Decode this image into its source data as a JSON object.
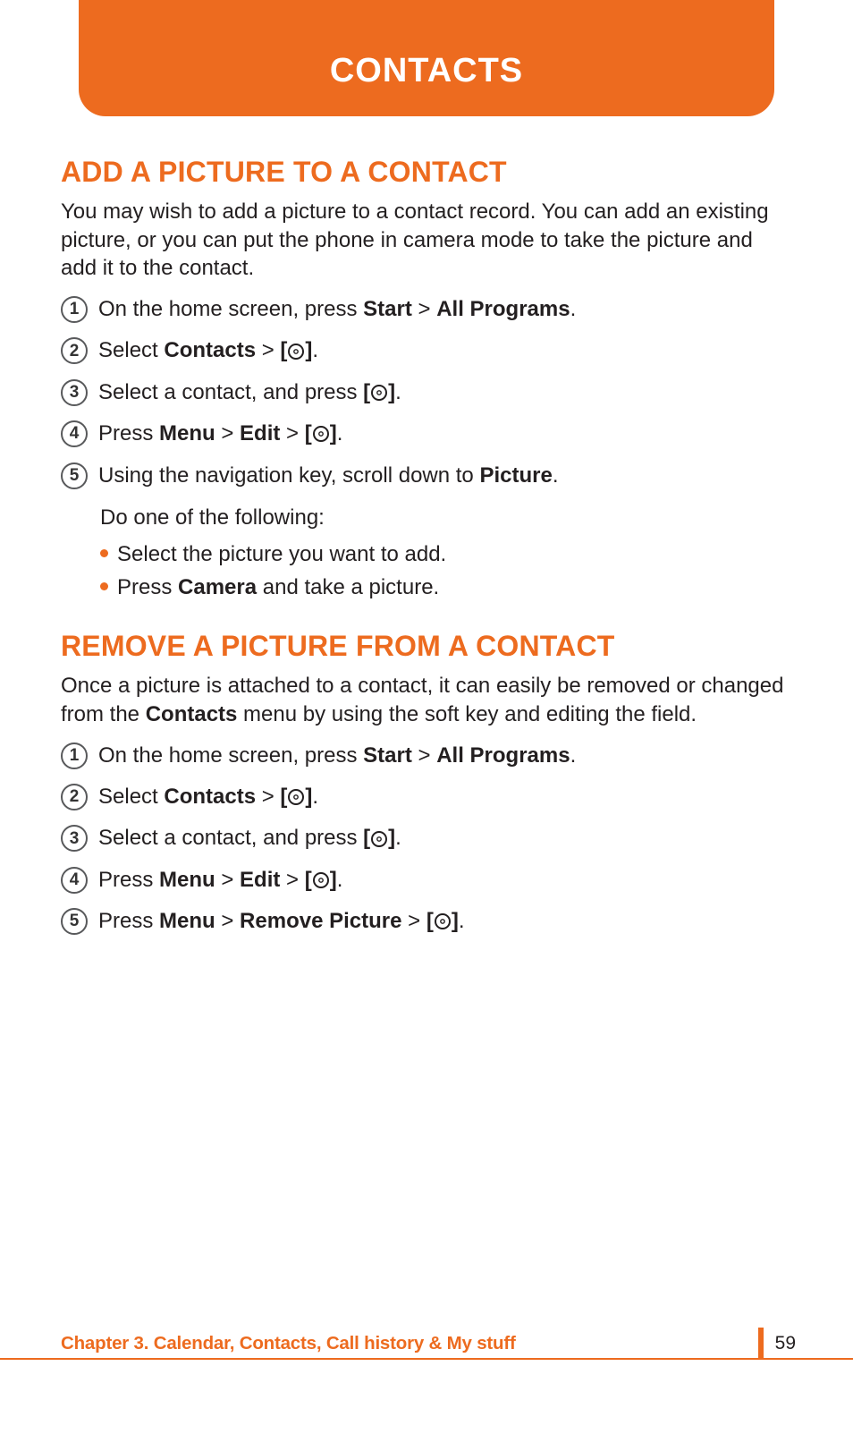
{
  "header": {
    "title": "CONTACTS"
  },
  "section1": {
    "heading": "ADD A PICTURE TO A CONTACT",
    "intro": "You may wish to add a picture to a contact record. You can add an existing picture, or you can put the phone in camera mode to take the picture and add it to the contact.",
    "steps": {
      "s1": {
        "num": "1",
        "a": "On the home screen, press ",
        "b": "Start",
        "c": " > ",
        "d": "All Programs",
        "e": "."
      },
      "s2": {
        "num": "2",
        "a": "Select ",
        "b": "Contacts",
        "c": " > ",
        "e": "."
      },
      "s3": {
        "num": "3",
        "a": "Select a contact, and press ",
        "e": "."
      },
      "s4": {
        "num": "4",
        "a": "Press ",
        "b": "Menu",
        "c": " > ",
        "d": "Edit",
        "f": " > ",
        "e": "."
      },
      "s5": {
        "num": "5",
        "a": "Using the navigation key, scroll down to ",
        "b": "Picture",
        "e": "."
      }
    },
    "sub": {
      "lead": "Do one of the following:",
      "b1": "Select the picture you want to add.",
      "b2a": "Press ",
      "b2b": "Camera",
      "b2c": " and take a picture."
    }
  },
  "section2": {
    "heading": "REMOVE A PICTURE FROM A CONTACT",
    "intro_a": "Once a picture is attached to a contact, it can easily be removed or changed from the ",
    "intro_b": "Contacts",
    "intro_c": " menu by using the soft key and editing the field.",
    "steps": {
      "s1": {
        "num": "1",
        "a": "On the home screen, press ",
        "b": "Start",
        "c": " > ",
        "d": "All Programs",
        "e": "."
      },
      "s2": {
        "num": "2",
        "a": "Select ",
        "b": "Contacts",
        "c": " > ",
        "e": "."
      },
      "s3": {
        "num": "3",
        "a": "Select a contact, and press ",
        "e": "."
      },
      "s4": {
        "num": "4",
        "a": "Press ",
        "b": "Menu",
        "c": " > ",
        "d": "Edit",
        "f": " > ",
        "e": "."
      },
      "s5": {
        "num": "5",
        "a": "Press ",
        "b": "Menu",
        "c": " > ",
        "d": "Remove Picture",
        "f": " > ",
        "e": "."
      }
    }
  },
  "footer": {
    "chapter": "Chapter 3. Calendar, Contacts, Call history & My stuff",
    "pagenum": "59"
  },
  "ok": {
    "open": "[",
    "close": "]"
  }
}
